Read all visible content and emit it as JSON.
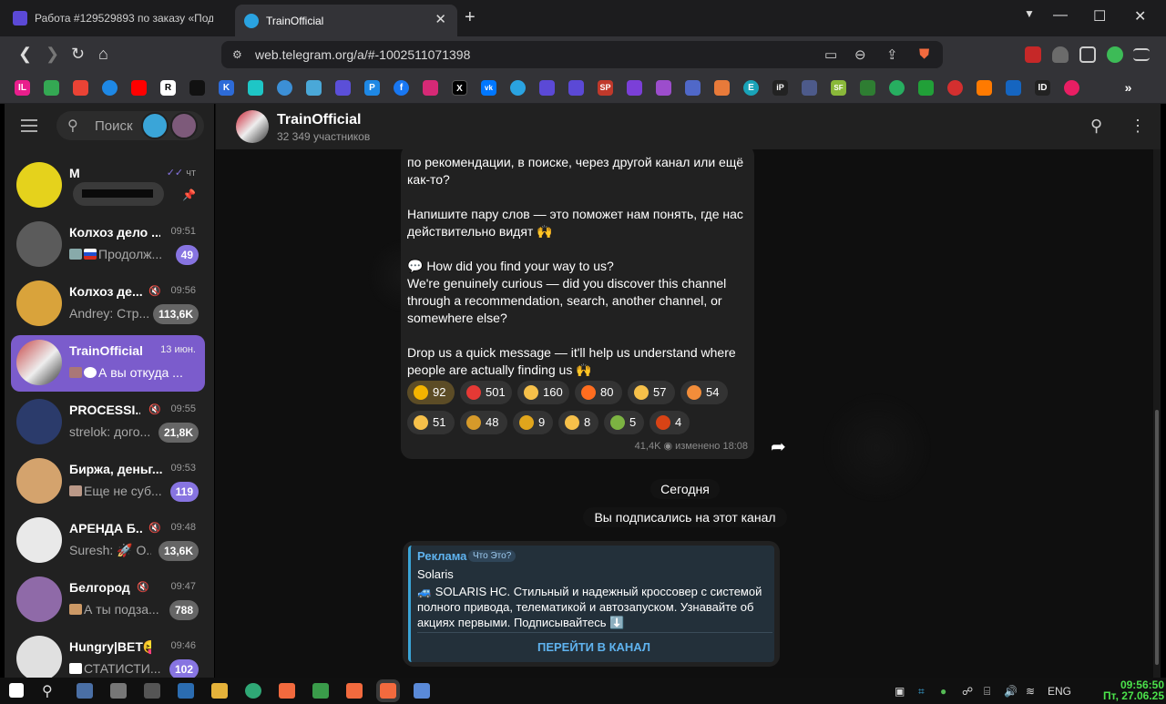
{
  "browser": {
    "tabs": [
      {
        "title": "Работа #129529893 по заказу «Подпи"
      },
      {
        "title": "TrainOfficial"
      }
    ],
    "url": "web.telegram.org/a/#-1002511071398"
  },
  "bookmarks": [
    "IL",
    "",
    "",
    "",
    "",
    "R",
    "",
    "K",
    "",
    "",
    "",
    "",
    "",
    "P",
    "f",
    "",
    "X",
    "vk",
    "",
    "",
    "",
    "",
    "",
    "SP",
    "",
    "",
    "",
    "",
    "",
    "",
    "",
    "E",
    "iP",
    "",
    "SF",
    "",
    "",
    "",
    "",
    "",
    "",
    "",
    "",
    "ID",
    ""
  ],
  "sidebar": {
    "search_placeholder": "Поиск",
    "chats": [
      {
        "name": "M",
        "time": "чт",
        "preview": "",
        "badge": "",
        "avatar_color": "#e5d21c"
      },
      {
        "name": "Колхоз дело ...",
        "time": "09:51",
        "preview": "Продолж...",
        "badge": "49",
        "avatar_color": "#5b5b5b"
      },
      {
        "name": "Колхоз де...",
        "time": "09:56",
        "preview": "Andrey: Стр...",
        "badge": "113,6K",
        "avatar_color": "#d9a33b"
      },
      {
        "name": "TrainOfficial",
        "time": "13 июн.",
        "preview": "А вы откуда ...",
        "badge": "",
        "avatar_color": "#c84848"
      },
      {
        "name": "PROCESSI...",
        "time": "09:55",
        "preview": "strelok: дого...",
        "badge": "21,8K",
        "avatar_color": "#2b3b6b"
      },
      {
        "name": "Биржа, деньг...",
        "time": "09:53",
        "preview": "Еще не суб...",
        "badge": "119",
        "avatar_color": "#d4a36d"
      },
      {
        "name": "АРЕНДА Б...",
        "time": "09:48",
        "preview": "Suresh: 🚀 О...",
        "badge": "13,6K",
        "avatar_color": "#e9e9e9"
      },
      {
        "name": "Белгород",
        "time": "09:47",
        "preview": "А ты подза...",
        "badge": "788",
        "avatar_color": "#8f6aa8"
      },
      {
        "name": "Hungry|BET😝",
        "time": "09:46",
        "preview": "СТАТИСТИ...",
        "badge": "102",
        "avatar_color": "#e0e0e0"
      }
    ]
  },
  "chat": {
    "title": "TrainOfficial",
    "subtitle": "32 349 участников",
    "message_lines_ru": [
      "по рекомендации, в поиске, через другой канал или ещё",
      "как-то?",
      "",
      "Напишите пару слов — это поможет нам понять, где нас",
      "действительно видят 🙌"
    ],
    "message_lines_en": [
      "💬 How did you find your way to us?",
      "We're genuinely curious — did you discover this channel",
      "through a recommendation, search, another channel, or",
      "somewhere else?",
      "",
      "Drop us a quick message — it'll help us understand where",
      "people are actually finding us 🙌"
    ],
    "reactions": [
      {
        "emoji": "⭐",
        "count": "92",
        "color": "#f4b400"
      },
      {
        "emoji": "❤️",
        "count": "501",
        "color": "#e53935"
      },
      {
        "emoji": "👍",
        "count": "160",
        "color": "#f6c04a"
      },
      {
        "emoji": "🔥",
        "count": "80",
        "color": "#ff6d1f"
      },
      {
        "emoji": "👏",
        "count": "57",
        "color": "#f6c04a"
      },
      {
        "emoji": "😍",
        "count": "54",
        "color": "#f28d3a"
      },
      {
        "emoji": "🤩",
        "count": "51",
        "color": "#f6c04a"
      },
      {
        "emoji": "🎉",
        "count": "48",
        "color": "#d69a2a"
      },
      {
        "emoji": "🏆",
        "count": "9",
        "color": "#e0a51c"
      },
      {
        "emoji": "👎",
        "count": "8",
        "color": "#f6c04a"
      },
      {
        "emoji": "🤮",
        "count": "5",
        "color": "#7cb342"
      },
      {
        "emoji": "😡",
        "count": "4",
        "color": "#d84315"
      }
    ],
    "views": "41,4K",
    "edited": "изменено 18:08",
    "date_pill": "Сегодня",
    "service_pill": "Вы подписались на этот канал",
    "ad": {
      "label": "Реклама",
      "what": "Что Это?",
      "name": "Solaris",
      "text": "🚙 SOLARIS HC. Стильный и надежный кроссовер с системой полного привода, телематикой и автозапуском. Узнавайте об акциях первыми. Подписывайтесь ⬇️",
      "button": "ПЕРЕЙТИ В КАНАЛ"
    }
  },
  "taskbar": {
    "lang": "ENG",
    "time": "09:56:50",
    "date": "Пт, 27.06.25"
  }
}
